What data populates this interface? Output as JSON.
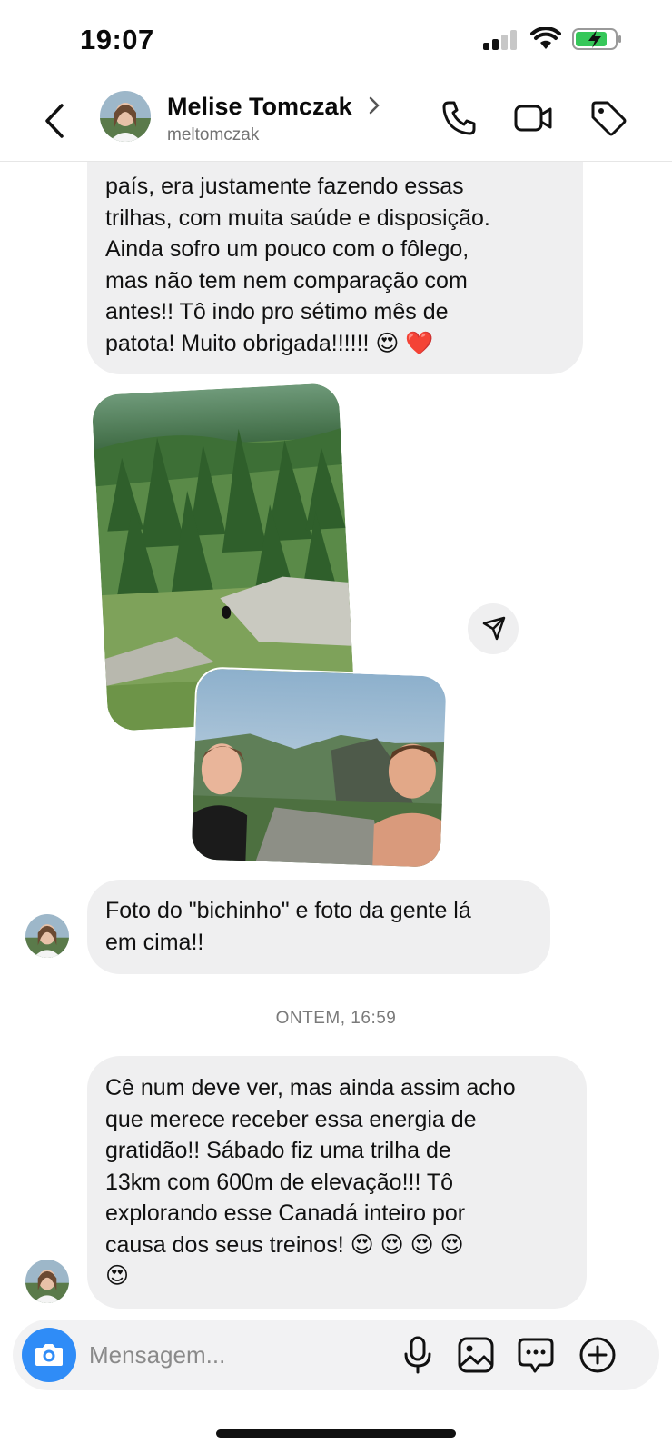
{
  "status_bar": {
    "time": "19:07"
  },
  "header": {
    "contact_name": "Melise Tomczak",
    "username": "meltomczak",
    "icons": [
      "back-chevron-icon",
      "phone-icon",
      "video-camera-icon",
      "tag-icon"
    ]
  },
  "messages": {
    "msg1": "país, era justamente fazendo essas\ntrilhas, com muita saúde e disposição.\nAinda sofro um pouco com o fôlego,\nmas não tem nem comparação com\nantes!! Tô indo pro sétimo mês de\npatota! Muito obrigada!!!!!! 😍 ❤️",
    "msg2": "Foto do \"bichinho\" e foto da gente lá\nem cima!!",
    "timestamp": "ONTEM, 16:59",
    "msg3": "Cê num deve ver, mas ainda assim acho\nque merece receber essa energia de\ngratidão!! Sábado fiz uma trilha de\n13km com 600m de elevação!!! Tô\nexplorando esse Canadá inteiro por\ncausa dos seus treinos! 😍 😍 😍 😍\n😍"
  },
  "composer": {
    "placeholder": "Mensagem..."
  },
  "colors": {
    "accent": "#2f8cf7",
    "bubble": "#efeff0"
  }
}
